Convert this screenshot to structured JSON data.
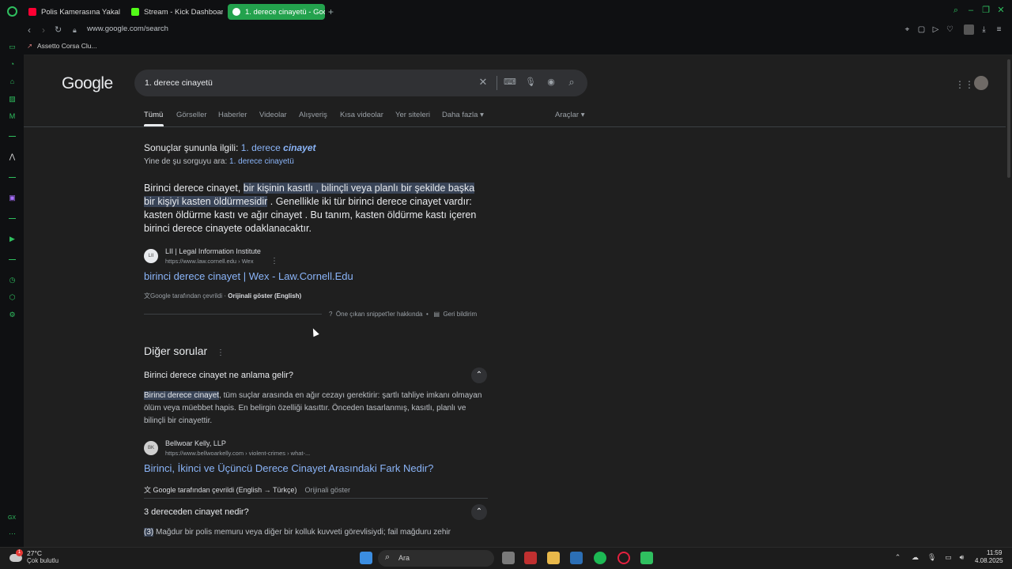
{
  "browser": {
    "tabs": [
      {
        "label": "Polis Kamerasına Yakalan",
        "favicon_color": "#ff0033"
      },
      {
        "label": "Stream - Kick Dashboard",
        "favicon_color": "#53fc18"
      },
      {
        "label": "1. derece cinayetü - Goog",
        "favicon_color": "#ffffff"
      }
    ],
    "url": "www.google.com/search",
    "bookmarks": [
      {
        "label": "Assetto Corsa Clu..."
      }
    ],
    "accent": "#23a24d"
  },
  "google": {
    "logo": "Google",
    "query": "1. derece cinayetü",
    "tabs": [
      "Tümü",
      "Görseller",
      "Haberler",
      "Videolar",
      "Alışveriş",
      "Kısa videolar",
      "Yer siteleri",
      "Daha fazla"
    ],
    "tools": "Araçlar",
    "spell": {
      "prefix": "Sonuçlar şununla ilgili:",
      "corrected_a": "1. derece",
      "corrected_b": "cinayet",
      "alt_prefix": "Yine de şu sorguyu ara:",
      "alt_link": "1. derece cinayetü"
    },
    "snippet": {
      "before": "Birinci derece cinayet, ",
      "highlight": "bir kişinin kasıtlı , bilinçli veya planlı bir şekilde başka bir kişiyi kasten öldürmesidir",
      "after": " . Genellikle iki tür birinci derece cinayet vardır: kasten öldürme kastı ve ağır cinayet . Bu tanım, kasten öldürme kastı içeren birinci derece cinayete odaklanacaktır.",
      "source_icon_text": "LII",
      "source_name": "LII | Legal Information Institute",
      "source_url": "https://www.law.cornell.edu › Wex",
      "title": "birinci derece cinayet | Wex - Law.Cornell.Edu",
      "translated": "Google tarafından çevrildi ·",
      "show_original": "Orijinali göster (English)",
      "about": "Öne çıkan snippet'ler hakkında",
      "dot": "•",
      "feedback": "Geri bildirim"
    },
    "paa": {
      "title": "Diğer sorular",
      "items": [
        {
          "question": "Birinci derece cinayet ne anlama gelir?",
          "answer_highlight": "Birinci derece cinayet",
          "answer_rest": ", tüm suçlar arasında en ağır cezayı gerektirir: şartlı tahliye imkanı olmayan ölüm veya müebbet hapis. En belirgin özelliği kasıttır. Önceden tasarlanmış, kasıtlı, planlı ve bilinçli bir cinayettir.",
          "source_icon_text": "BK",
          "source_name": "Bellwoar Kelly, LLP",
          "source_url": "https://www.bellwoarkelly.com › violent-crimes › what-...",
          "title": "Birinci, İkinci ve Üçüncü Derece Cinayet Arasındaki Fark Nedir?",
          "translated": "Google tarafından çevrildi (English → Türkçe)",
          "show_original": "Orijinali göster"
        },
        {
          "question": "3 dereceden cinayet nedir?",
          "answer_highlight": "(3)",
          "answer_rest": " Mağdur bir polis memuru veya diğer bir kolluk kuvveti görevlisiydi; fail mağduru zehir"
        }
      ]
    }
  },
  "taskbar": {
    "temp": "27°C",
    "condition": "Çok bulutlu",
    "weather_badge": "1",
    "search_label": "Ara",
    "time": "11:59",
    "date": "4.08.2025"
  }
}
